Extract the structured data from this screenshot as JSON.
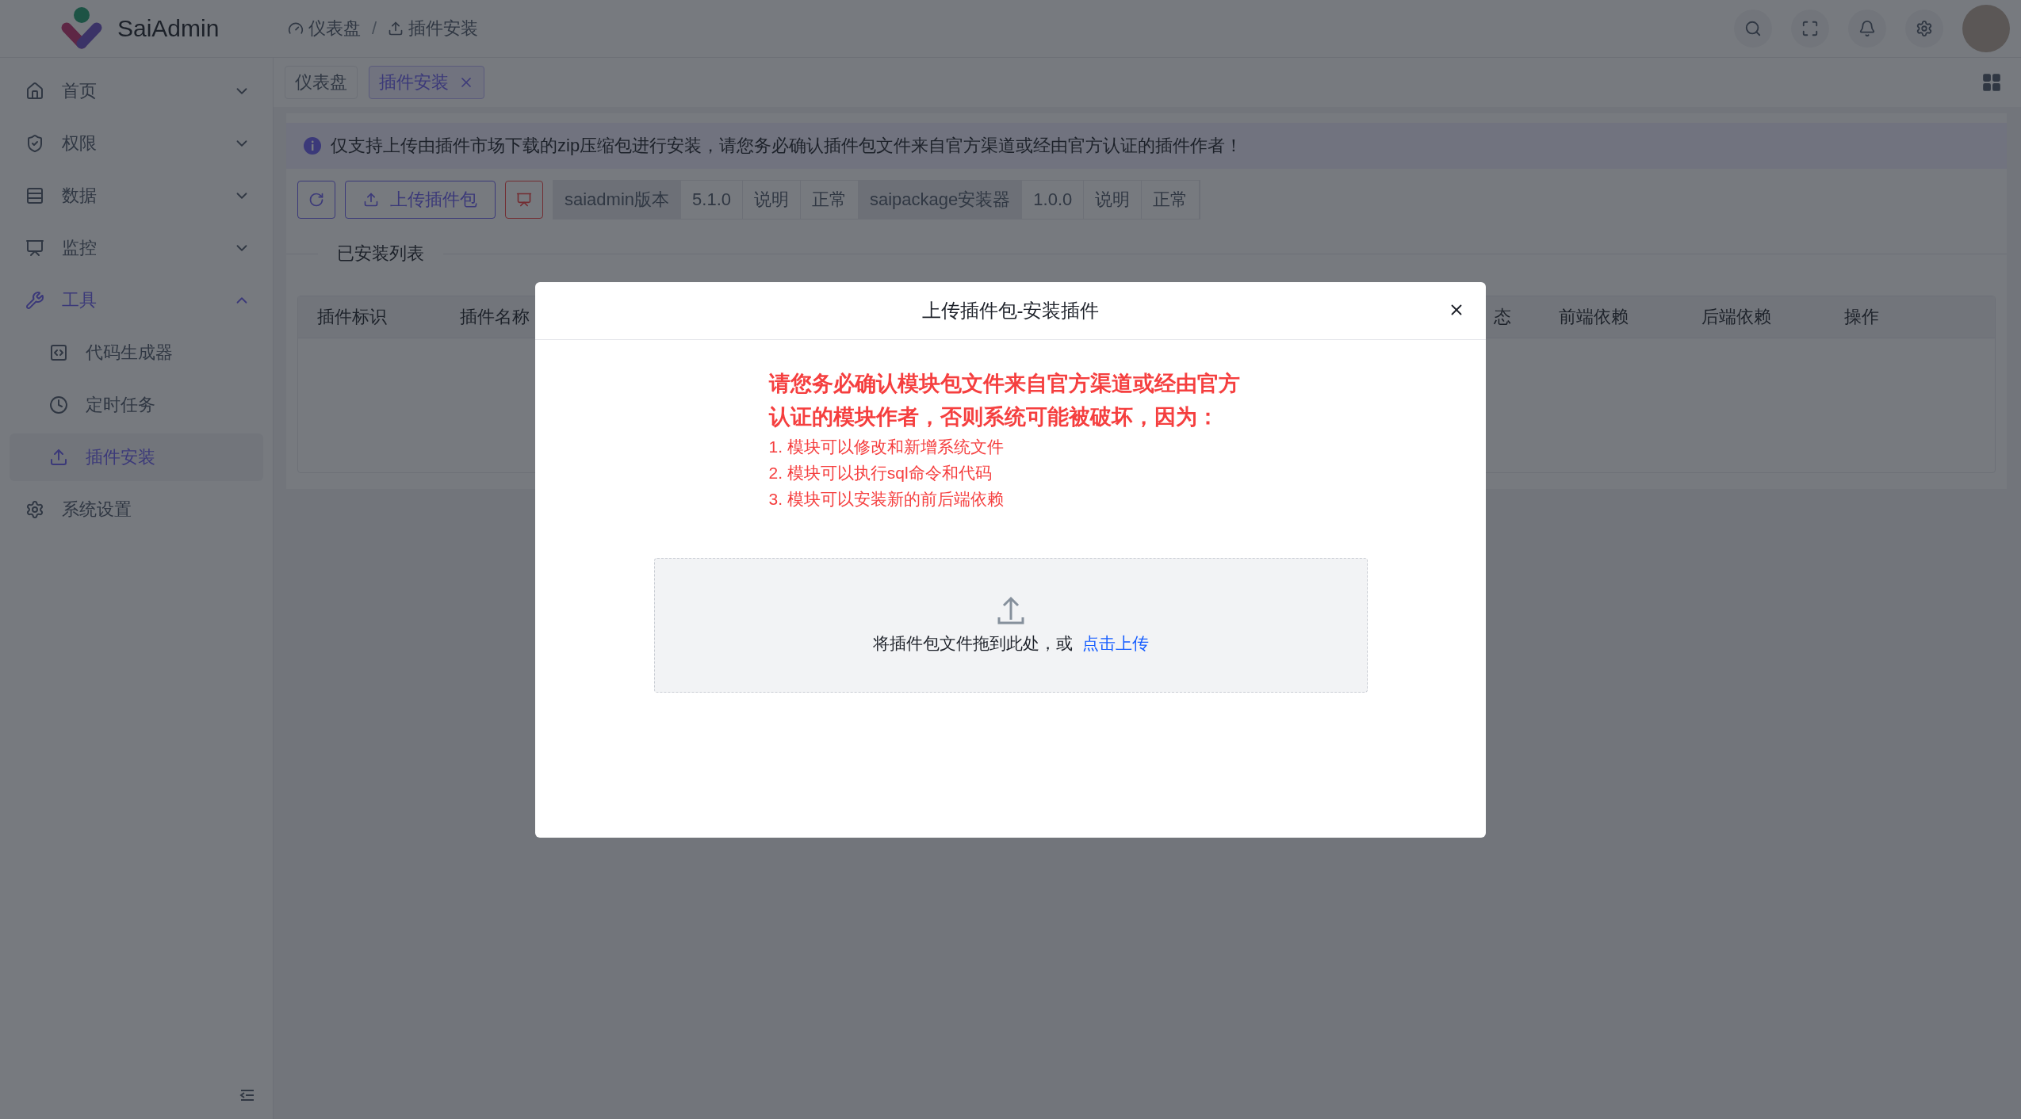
{
  "header": {
    "app_name": "SaiAdmin",
    "breadcrumb_separator": "/",
    "breadcrumb": [
      {
        "label": "仪表盘"
      },
      {
        "label": "插件安装"
      }
    ]
  },
  "sidebar": {
    "items": [
      {
        "label": "首页",
        "expanded": false
      },
      {
        "label": "权限",
        "expanded": false
      },
      {
        "label": "数据",
        "expanded": false
      },
      {
        "label": "监控",
        "expanded": false
      },
      {
        "label": "工具",
        "expanded": true,
        "children": [
          {
            "label": "代码生成器",
            "selected": false
          },
          {
            "label": "定时任务",
            "selected": false
          },
          {
            "label": "插件安装",
            "selected": true
          }
        ]
      },
      {
        "label": "系统设置"
      }
    ]
  },
  "tabs": [
    {
      "label": "仪表盘",
      "selected": false,
      "closable": false
    },
    {
      "label": "插件安装",
      "selected": true,
      "closable": true
    }
  ],
  "alert": {
    "text": "仅支持上传由插件市场下载的zip压缩包进行安装，请您务必确认插件包文件来自官方渠道或经由官方认证的插件作者！"
  },
  "toolbar": {
    "upload_button": "上传插件包",
    "info_cells": [
      {
        "kind": "label",
        "text": "saiadmin版本"
      },
      {
        "kind": "value",
        "text": "5.1.0"
      },
      {
        "kind": "value",
        "text": "说明"
      },
      {
        "kind": "value",
        "text": "正常"
      },
      {
        "kind": "label",
        "text": "saipackage安装器"
      },
      {
        "kind": "value",
        "text": "1.0.0"
      },
      {
        "kind": "value",
        "text": "说明"
      },
      {
        "kind": "value",
        "text": "正常"
      }
    ]
  },
  "section_title": "已安装列表",
  "table": {
    "columns": [
      "插件标识",
      "插件名称",
      "态",
      "前端依赖",
      "后端依赖",
      "操作"
    ]
  },
  "modal": {
    "title": "上传插件包-安装插件",
    "warning": "请您务必确认模块包文件来自官方渠道或经由官方认证的模块作者，否则系统可能被破坏，因为：",
    "reasons": [
      "1. 模块可以修改和新增系统文件",
      "2. 模块可以执行sql命令和代码",
      "3. 模块可以安装新的前后端依赖"
    ],
    "dropzone": {
      "text": "将插件包文件拖到此处，或",
      "link": "点击上传"
    }
  }
}
